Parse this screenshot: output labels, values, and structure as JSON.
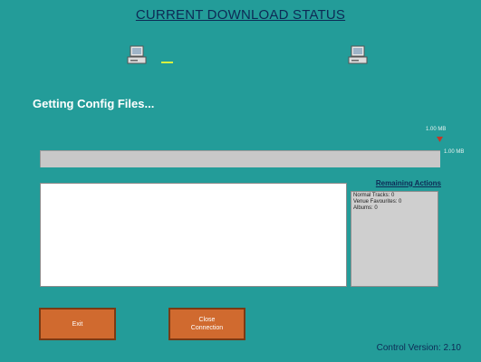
{
  "title": "CURRENT DOWNLOAD STATUS",
  "status_text": "Getting Config Files...",
  "progress": {
    "top_size_label": "1.00 MB",
    "side_size_label": "1.00 MB",
    "fill_fraction": 0
  },
  "remaining_actions": {
    "heading": "Remaining Actions",
    "items": [
      "Normal Tracks: 0",
      "Venue Favourites: 0",
      "Albums: 0"
    ]
  },
  "buttons": {
    "exit": "Exit",
    "close_connection": "Close\nConnection"
  },
  "footer": {
    "version": "Control Version: 2.10"
  },
  "icons": {
    "local": "computer-icon",
    "remote": "computer-icon"
  },
  "colors": {
    "background": "#239c99",
    "button": "#d06a2f",
    "title": "#0d2a55"
  }
}
